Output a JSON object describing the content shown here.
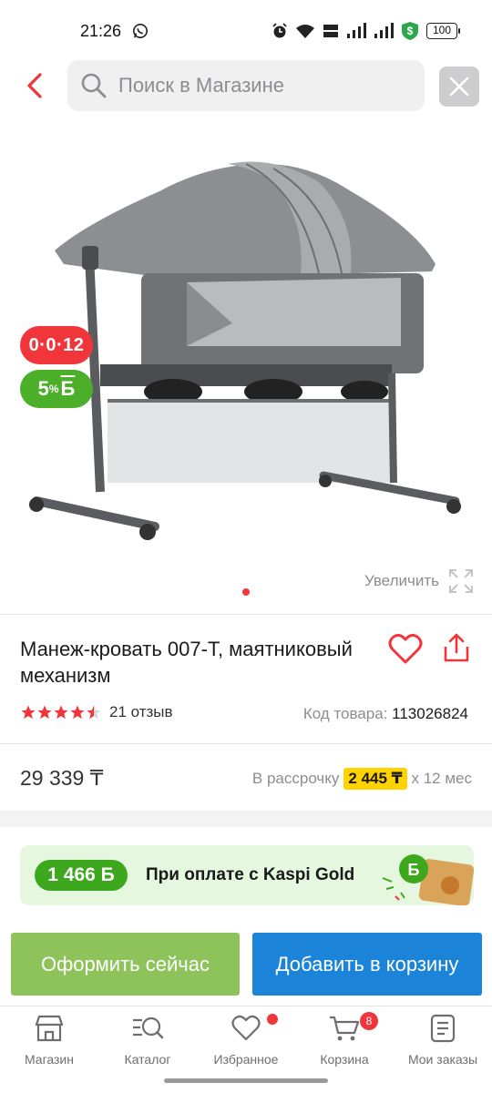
{
  "status_bar": {
    "time": "21:26",
    "battery": "100"
  },
  "search": {
    "placeholder": "Поиск в Магазине"
  },
  "product": {
    "badge_timer": "0·0·12",
    "badge_bonus_percent": "5",
    "badge_bonus_symbol": "Б",
    "zoom_label": "Увеличить",
    "title": "Манеж-кровать 007-T, маятниковый механизм",
    "rating": 4.5,
    "reviews": "21 отзыв",
    "sku_label": "Код товара:",
    "sku_value": "113026824",
    "price": "29 339 ₸",
    "installment_prefix": "В рассрочку",
    "installment_amount": "2 445 ₸",
    "installment_suffix": "x 12 мес"
  },
  "kaspi_gold": {
    "bonus": "1 466 Б",
    "text": "При оплате с Kaspi Gold"
  },
  "actions": {
    "buy_now": "Оформить сейчас",
    "add_to_cart": "Добавить в корзину"
  },
  "nav": {
    "items": [
      {
        "label": "Магазин",
        "icon": "shop-icon"
      },
      {
        "label": "Каталог",
        "icon": "catalog-search-icon"
      },
      {
        "label": "Избранное",
        "icon": "heart-icon"
      },
      {
        "label": "Корзина",
        "icon": "cart-icon"
      },
      {
        "label": "Мои заказы",
        "icon": "orders-icon"
      }
    ],
    "cart_count": "8"
  },
  "colors": {
    "red": "#f0353b",
    "green": "#4caf2a",
    "blue": "#1b84d8",
    "light_green": "#8ec35b",
    "yellow": "#ffd200"
  }
}
